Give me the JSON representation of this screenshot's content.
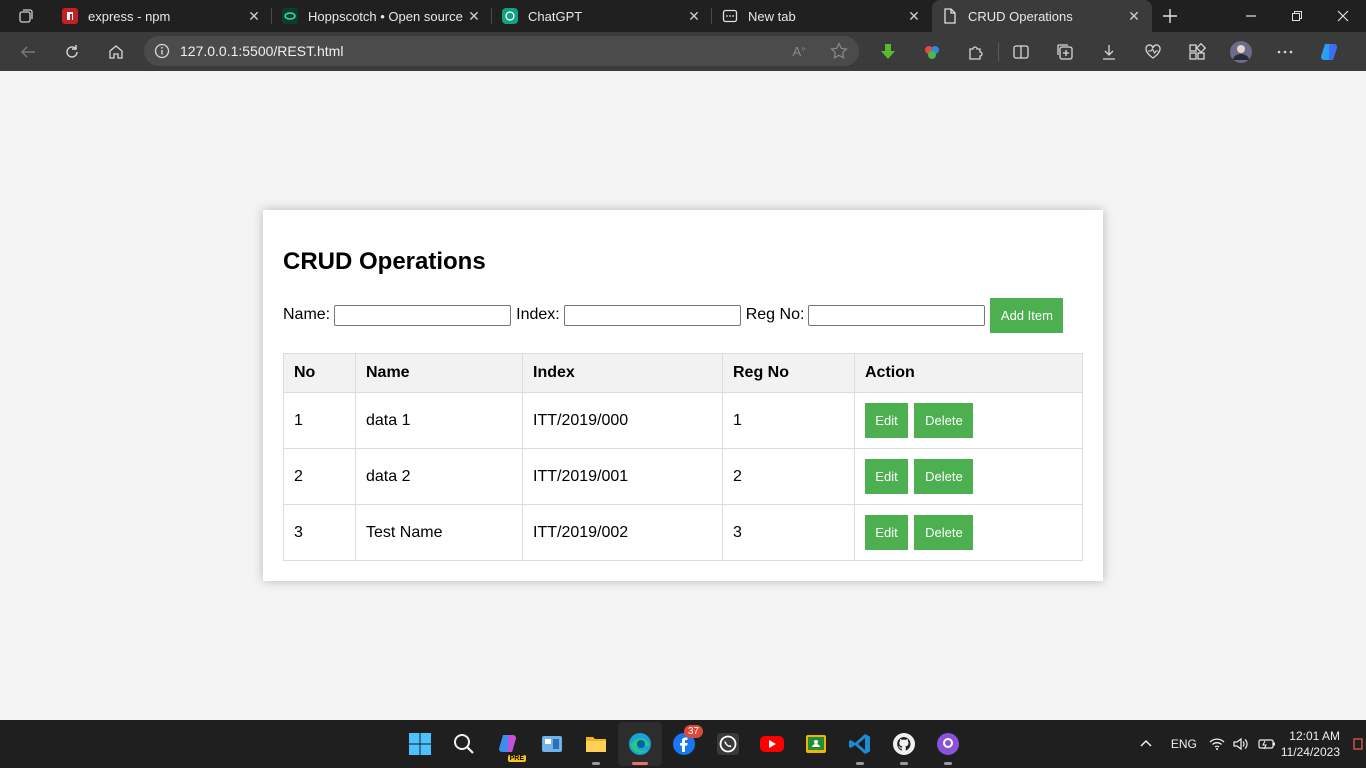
{
  "browser": {
    "tabs": [
      {
        "title": "express - npm",
        "icon": "npm-icon"
      },
      {
        "title": "Hoppscotch • Open source API",
        "icon": "hoppscotch-icon"
      },
      {
        "title": "ChatGPT",
        "icon": "chatgpt-icon"
      },
      {
        "title": "New tab",
        "icon": "newtab-icon"
      },
      {
        "title": "CRUD Operations",
        "icon": "page-icon",
        "active": true
      }
    ],
    "url": "127.0.0.1:5500/REST.html"
  },
  "page": {
    "title": "CRUD Operations",
    "form": {
      "name_label": "Name:",
      "index_label": "Index:",
      "regno_label": "Reg No:",
      "add_button": "Add Item"
    },
    "table": {
      "headers": [
        "No",
        "Name",
        "Index",
        "Reg No",
        "Action"
      ],
      "rows": [
        {
          "no": "1",
          "name": "data 1",
          "index": "ITT/2019/000",
          "regno": "1",
          "edit": "Edit",
          "delete": "Delete"
        },
        {
          "no": "2",
          "name": "data 2",
          "index": "ITT/2019/001",
          "regno": "2",
          "edit": "Edit",
          "delete": "Delete"
        },
        {
          "no": "3",
          "name": "Test Name",
          "index": "ITT/2019/002",
          "regno": "3",
          "edit": "Edit",
          "delete": "Delete"
        }
      ]
    }
  },
  "taskbar": {
    "facebook_badge": "37",
    "copilot_badge": "PRE",
    "language": "ENG",
    "time": "12:01 AM",
    "date": "11/24/2023"
  },
  "colors": {
    "accent_green": "#4caf50",
    "chrome_dark": "#202020",
    "toolbar": "#3b3b3b"
  }
}
